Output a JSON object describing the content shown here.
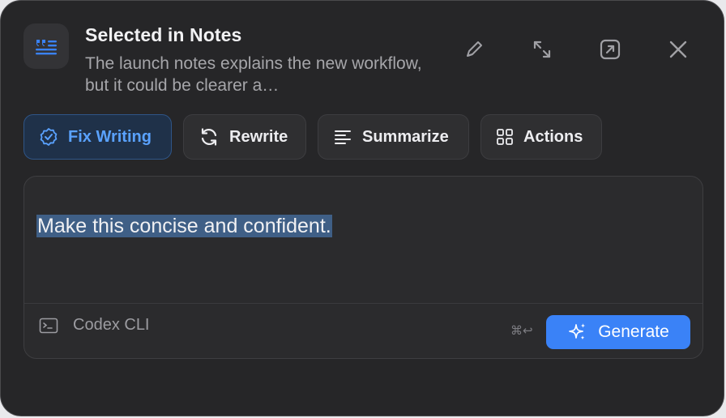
{
  "header": {
    "title": "Selected in Notes",
    "subtitle": "The launch notes explains the new workflow, but it could be clearer a…",
    "app_icon": "notes-quote-icon",
    "actions": [
      {
        "name": "edit",
        "icon": "pencil-icon"
      },
      {
        "name": "expand",
        "icon": "expand-arrows-icon"
      },
      {
        "name": "open-external",
        "icon": "open-external-icon"
      },
      {
        "name": "close",
        "icon": "close-icon"
      }
    ]
  },
  "chips": [
    {
      "label": "Fix Writing",
      "icon": "badge-check-icon",
      "active": true
    },
    {
      "label": "Rewrite",
      "icon": "refresh-icon",
      "active": false
    },
    {
      "label": "Summarize",
      "icon": "lines-icon",
      "active": false
    },
    {
      "label": "Actions",
      "icon": "grid-icon",
      "active": false
    }
  ],
  "editor": {
    "prompt": "Make this concise and confident.",
    "engine_label": "Codex CLI",
    "engine_icon": "terminal-icon",
    "shortcut": "⌘↩",
    "generate_label": "Generate",
    "generate_icon": "sparkles-icon"
  },
  "colors": {
    "accent": "#3a82f7",
    "active_chip_text": "#5aa2ff",
    "panel_bg": "#262628"
  }
}
